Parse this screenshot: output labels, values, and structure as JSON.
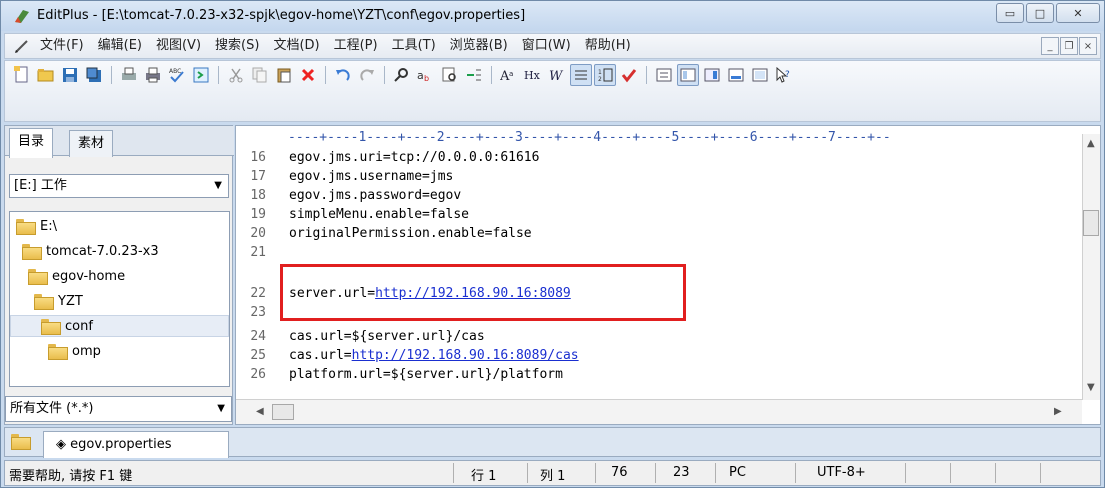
{
  "window": {
    "title": "EditPlus - [E:\\tomcat-7.0.23-x32-spjk\\egov-home\\YZT\\conf\\egov.properties]",
    "controls": {
      "minimize": "▭",
      "maximize": "□",
      "close": "✕"
    }
  },
  "menubar": {
    "items": [
      "文件(F)",
      "编辑(E)",
      "视图(V)",
      "搜索(S)",
      "文档(D)",
      "工程(P)",
      "工具(T)",
      "浏览器(B)",
      "窗口(W)",
      "帮助(H)"
    ],
    "mdi": {
      "minimize": "_",
      "restore": "❐",
      "close": "×"
    }
  },
  "sidebar": {
    "tabs": [
      "目录",
      "素材"
    ],
    "drive": "[E:] 工作",
    "tree": [
      {
        "label": "E:\\"
      },
      {
        "label": "tomcat-7.0.23-x3"
      },
      {
        "label": "egov-home"
      },
      {
        "label": "YZT"
      },
      {
        "label": "conf"
      },
      {
        "label": "omp"
      }
    ],
    "filter": "所有文件 (*.*)"
  },
  "editor": {
    "ruler": "----+----1----+----2----+----3----+----4----+----5----+----6----+----7----+--",
    "lines": [
      {
        "n": "16",
        "text": "egov.jms.uri=tcp://0.0.0.0:61616"
      },
      {
        "n": "17",
        "text": "egov.jms.username=jms"
      },
      {
        "n": "18",
        "text": "egov.jms.password=egov"
      },
      {
        "n": "19",
        "text": "simpleMenu.enable=false"
      },
      {
        "n": "20",
        "text": "originalPermission.enable=false"
      },
      {
        "n": "21",
        "text": ""
      },
      {
        "n": "22",
        "pre": "server.url=",
        "link": "http://192.168.90.16:8089"
      },
      {
        "n": "23",
        "text": ""
      },
      {
        "n": "24",
        "text": "cas.url=${server.url}/cas"
      },
      {
        "n": "25",
        "pre": "cas.url=",
        "link": "http://192.168.90.16:8089/cas"
      },
      {
        "n": "26",
        "text": "platform.url=${server.url}/platform"
      }
    ]
  },
  "doctab": {
    "label": "◈ egov.properties"
  },
  "statusbar": {
    "help": "需要帮助, 请按 F1 键",
    "row": "行 1",
    "col": "列 1",
    "chars": "76",
    "lines": "23",
    "mode": "PC",
    "encoding": "UTF-8+"
  }
}
